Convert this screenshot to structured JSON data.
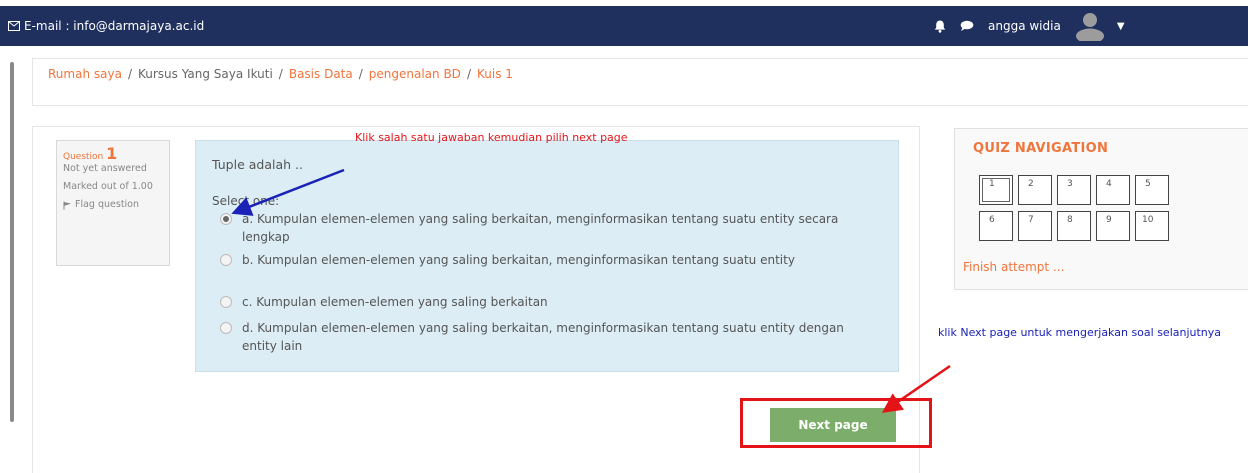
{
  "topbar": {
    "email": "E-mail : info@darmajaya.ac.id",
    "username": "angga widia",
    "icons": [
      "envelope-icon",
      "bell-icon",
      "chat-icon",
      "avatar",
      "caret-down-icon"
    ]
  },
  "breadcrumb": {
    "items": [
      "Rumah saya",
      "Kursus Yang Saya Ikuti",
      "Basis Data",
      "pengenalan BD",
      "Kuis 1"
    ],
    "separator": "/"
  },
  "question_info": {
    "label": "Question",
    "number": "1",
    "status": "Not yet answered",
    "marked": "Marked out of 1.00",
    "flag": "Flag question"
  },
  "question": {
    "text": "Tuple adalah ..",
    "prompt": "Select one:",
    "answers": [
      {
        "label": "a. Kumpulan elemen-elemen yang saling berkaitan, menginformasikan tentang suatu entity secara lengkap",
        "checked": true
      },
      {
        "label": "b. Kumpulan elemen-elemen yang saling berkaitan, menginformasikan tentang suatu entity",
        "checked": false
      },
      {
        "label": "c. Kumpulan elemen-elemen yang saling berkaitan",
        "checked": false
      },
      {
        "label": "d. Kumpulan elemen-elemen yang saling berkaitan, menginformasikan tentang suatu entity dengan entity lain",
        "checked": false
      }
    ]
  },
  "quiz_nav": {
    "title": "QUIZ NAVIGATION",
    "buttons": [
      "1",
      "2",
      "3",
      "4",
      "5",
      "6",
      "7",
      "8",
      "9",
      "10"
    ],
    "current": 1,
    "finish": "Finish attempt ..."
  },
  "next_button": "Next page",
  "annotations": {
    "answer_hint": "Klik salah satu jawaban kemudian pilih next page",
    "next_hint": "klik Next page untuk mengerjakan soal selanjutnya"
  },
  "colors": {
    "topbar": "#1f2f5e",
    "accent": "#f0753c",
    "question_bg": "#dcedf5",
    "next_button": "#7cad6a",
    "annotation_red": "#e0161b",
    "annotation_blue": "#1a22b8"
  }
}
